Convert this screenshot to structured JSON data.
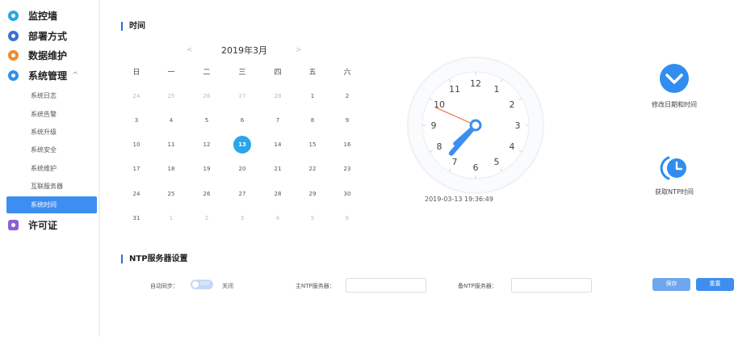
{
  "sidebar": {
    "items": [
      {
        "label": "监控墙",
        "color": "#2aa6e8"
      },
      {
        "label": "部署方式",
        "color": "#3d6fd6"
      },
      {
        "label": "数据维护",
        "color": "#f08a2a"
      },
      {
        "label": "系统管理",
        "color": "#2f8ef0",
        "expanded": true,
        "chevron": "^"
      },
      {
        "label": "许可证",
        "color": "#8a63d2"
      }
    ],
    "sub_items": [
      {
        "label": "系统日志"
      },
      {
        "label": "系统告警"
      },
      {
        "label": "系统升级"
      },
      {
        "label": "系统安全"
      },
      {
        "label": "系统维护"
      },
      {
        "label": "互联服务器"
      },
      {
        "label": "系统时间",
        "active": true
      }
    ]
  },
  "time_section": {
    "title": "时间",
    "calendar": {
      "month_label": "2019年3月",
      "prev_icon": "<",
      "next_icon": ">",
      "weekdays": [
        "日",
        "一",
        "二",
        "三",
        "四",
        "五",
        "六"
      ],
      "weeks": [
        [
          "24",
          "25",
          "26",
          "27",
          "28",
          "1",
          "2"
        ],
        [
          "3",
          "4",
          "5",
          "6",
          "7",
          "8",
          "9"
        ],
        [
          "10",
          "11",
          "12",
          "13",
          "14",
          "15",
          "16"
        ],
        [
          "17",
          "18",
          "19",
          "20",
          "21",
          "22",
          "23"
        ],
        [
          "24",
          "25",
          "26",
          "27",
          "28",
          "29",
          "30"
        ],
        [
          "31",
          "1",
          "2",
          "3",
          "4",
          "5",
          "6"
        ]
      ],
      "selected_day": "13"
    },
    "clock": {
      "numbers": [
        "12",
        "1",
        "2",
        "3",
        "4",
        "5",
        "6",
        "7",
        "8",
        "9",
        "10",
        "11"
      ],
      "hour": 19,
      "minute": 36,
      "second": 49,
      "readout": "2019-03-13 19:36:49"
    },
    "actions": {
      "modify_label": "修改日期和时间",
      "ntp_label": "获取NTP时间"
    }
  },
  "ntp_section": {
    "title": "NTP服务器设置",
    "auto_sync_label": "自动同步：",
    "toggle_text": "OFF",
    "toggle_state_label": "关闭",
    "primary_label": "主NTP服务器：",
    "primary_value": "",
    "backup_label": "备NTP服务器：",
    "backup_value": "",
    "save_label": "保存",
    "reset_label": "重置"
  },
  "colors": {
    "accent": "#3d8ef0",
    "today": "#2aa6e8",
    "clock_hand": "#3d8ef0",
    "second_hand": "#e8734a"
  }
}
